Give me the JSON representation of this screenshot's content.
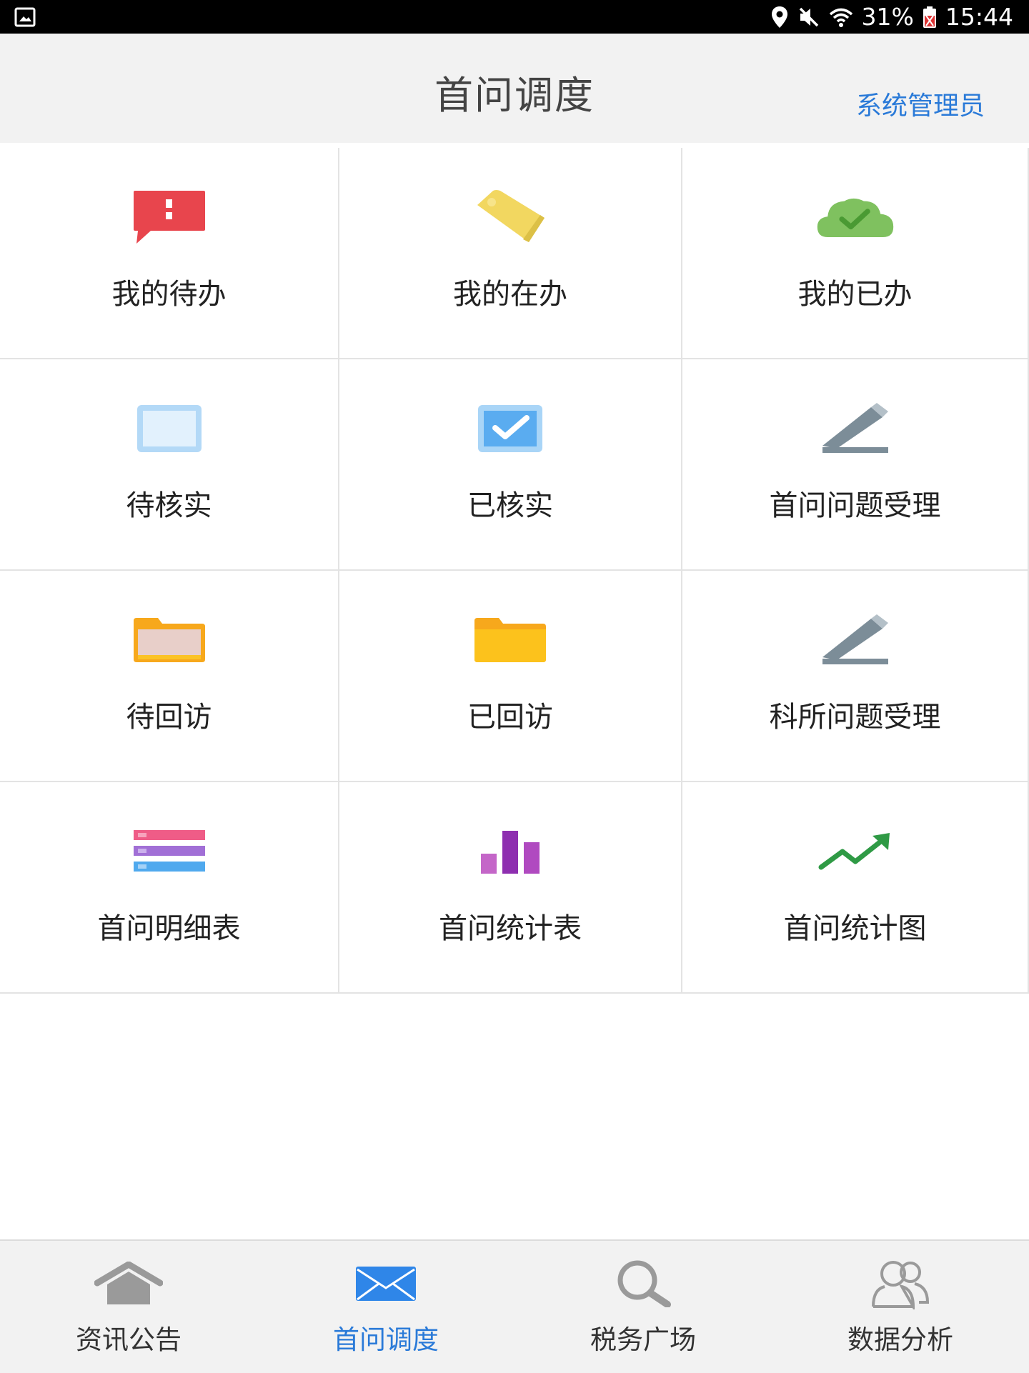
{
  "status_bar": {
    "battery": "31%",
    "time": "15:44"
  },
  "header": {
    "title": "首问调度",
    "user": "系统管理员"
  },
  "grid": [
    {
      "label": "我的待办",
      "icon": "alert-chat-icon"
    },
    {
      "label": "我的在办",
      "icon": "tag-icon"
    },
    {
      "label": "我的已办",
      "icon": "cloud-check-icon"
    },
    {
      "label": "待核实",
      "icon": "blank-box-icon"
    },
    {
      "label": "已核实",
      "icon": "checked-box-icon"
    },
    {
      "label": "首问问题受理",
      "icon": "pen-icon"
    },
    {
      "label": "待回访",
      "icon": "folder-open-icon"
    },
    {
      "label": "已回访",
      "icon": "folder-icon"
    },
    {
      "label": "科所问题受理",
      "icon": "pen-icon"
    },
    {
      "label": "首问明细表",
      "icon": "list-icon"
    },
    {
      "label": "首问统计表",
      "icon": "bar-chart-icon"
    },
    {
      "label": "首问统计图",
      "icon": "trend-line-icon"
    }
  ],
  "bottom_nav": [
    {
      "label": "资讯公告",
      "icon": "home-icon",
      "active": false
    },
    {
      "label": "首问调度",
      "icon": "envelope-icon",
      "active": true
    },
    {
      "label": "税务广场",
      "icon": "search-icon",
      "active": false
    },
    {
      "label": "数据分析",
      "icon": "users-icon",
      "active": false
    }
  ],
  "colors": {
    "accent": "#2a7ad8",
    "header_bg": "#f2f2f2",
    "status_bar_bg": "#000000"
  }
}
